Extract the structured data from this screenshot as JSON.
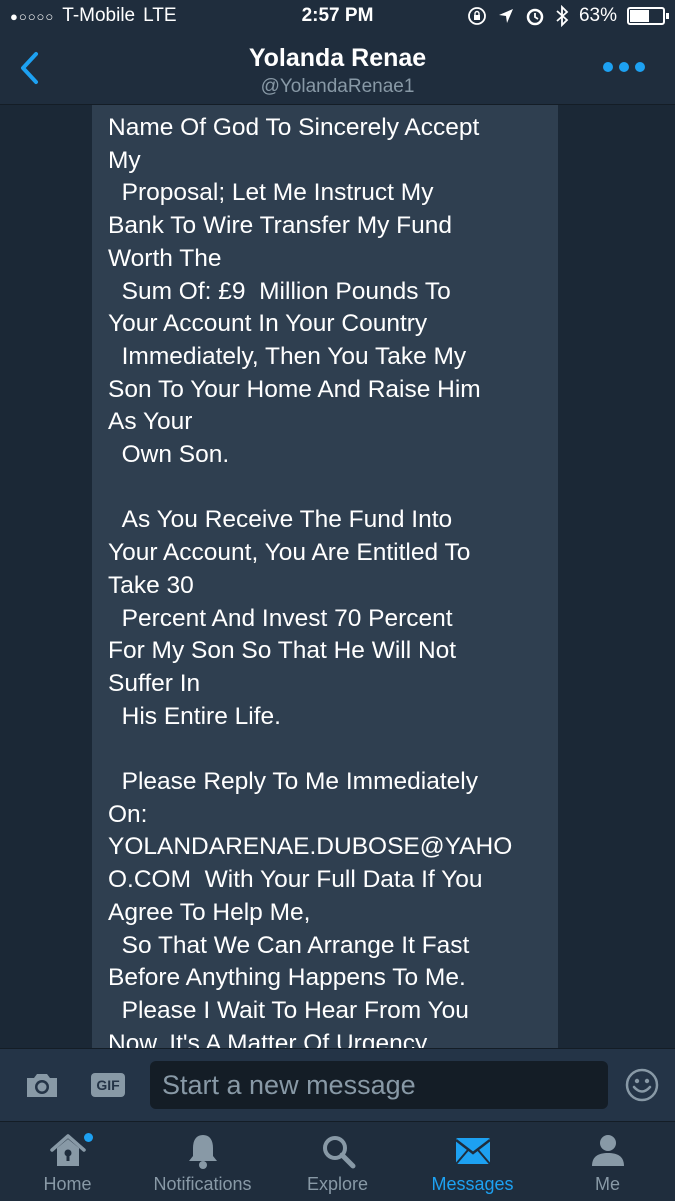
{
  "status_bar": {
    "signal": "●○○○○",
    "carrier": "T-Mobile",
    "network": "LTE",
    "time": "2:57 PM",
    "battery": "63%",
    "battery_level": 0.63
  },
  "header": {
    "name": "Yolanda Renae",
    "handle": "@YolandaRenae1",
    "back_icon": "chevron-left-icon",
    "more_icon": "more-dots-icon"
  },
  "message": {
    "text": "Name Of God To Sincerely Accept\nMy\n  Proposal; Let Me Instruct My\nBank To Wire Transfer My Fund\nWorth The\n  Sum Of: £9  Million Pounds To\nYour Account In Your Country\n  Immediately, Then You Take My\nSon To Your Home And Raise Him\nAs Your\n  Own Son.\n\n  As You Receive The Fund Into\nYour Account, You Are Entitled To\nTake 30\n  Percent And Invest 70 Percent\nFor My Son So That He Will Not\nSuffer In\n  His Entire Life.\n\n  Please Reply To Me Immediately\nOn:\nYOLANDARENAE.DUBOSE@YAHO\nO.COM  With Your Full Data If You\nAgree To Help Me,\n  So That We Can Arrange It Fast\nBefore Anything Happens To Me.\n  Please I Wait To Hear From You\nNow, It's A Matter Of Urgency."
  },
  "compose": {
    "placeholder": "Start a new message",
    "gif_label": "GIF"
  },
  "tabs": [
    {
      "label": "Home",
      "icon": "home-icon",
      "active": false
    },
    {
      "label": "Notifications",
      "icon": "bell-icon",
      "active": false
    },
    {
      "label": "Explore",
      "icon": "search-icon",
      "active": false
    },
    {
      "label": "Messages",
      "icon": "envelope-icon",
      "active": true
    },
    {
      "label": "Me",
      "icon": "person-icon",
      "active": false
    }
  ],
  "colors": {
    "background": "#1b2836",
    "bars": "#1f2d3d",
    "bubble": "#2f3f50",
    "accent": "#1da1f2",
    "muted": "#8899a6"
  }
}
